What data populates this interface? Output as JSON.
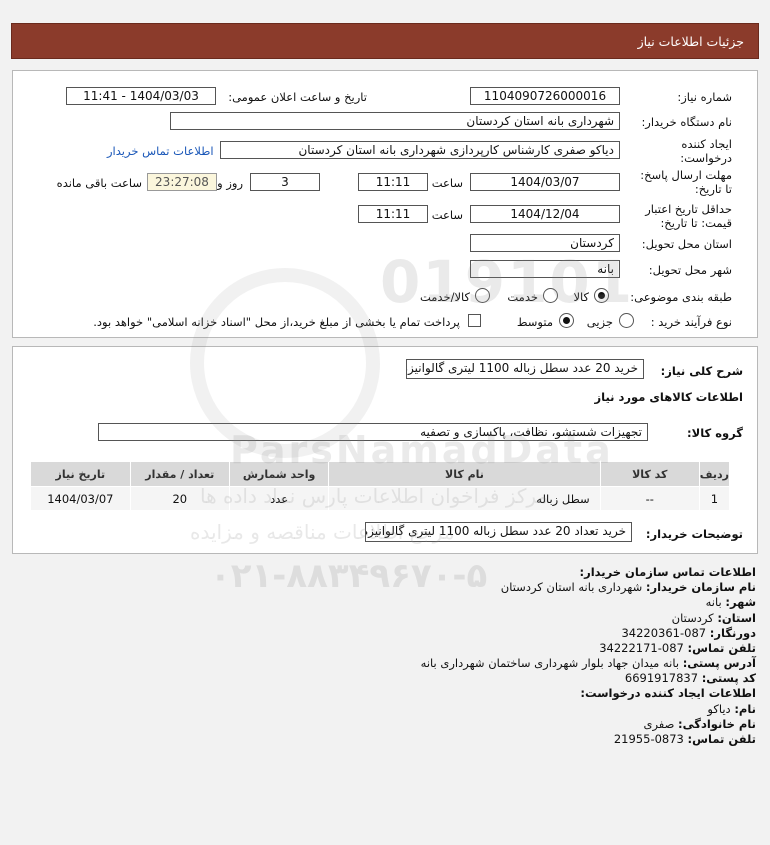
{
  "header": {
    "title": "جزئیات اطلاعات نیاز"
  },
  "form": {
    "need_number_label": "شماره نیاز:",
    "need_number": "1104090726000016",
    "announce_label": "تاریخ و ساعت اعلان عمومی:",
    "announce_value": "1404/03/03 - 11:41",
    "buyer_org_label": "نام دستگاه خریدار:",
    "buyer_org": "شهرداری بانه استان کردستان",
    "creator_label_1": "ایجاد کننده",
    "creator_label_2": "درخواست:",
    "creator": "دیاکو صفری کارشناس کارپردازی شهرداری بانه استان کردستان",
    "buyer_contact_link": "اطلاعات تماس خریدار",
    "deadline_label_1": "مهلت ارسال پاسخ:",
    "deadline_label_2": "تا تاریخ:",
    "deadline_date": "1404/03/07",
    "time_label": "ساعت",
    "deadline_time": "11:11",
    "days_value": "3",
    "days_label": "روز و",
    "remaining_time": "23:27:08",
    "remaining_label": "ساعت باقی مانده",
    "validity_label_1": "حداقل تاریخ اعتبار",
    "validity_label_2": "قیمت: تا تاریخ:",
    "validity_date": "1404/12/04",
    "validity_time": "11:11",
    "province_label": "استان محل تحویل:",
    "province": "کردستان",
    "city_label": "شهر محل تحویل:",
    "city": "بانه",
    "category_label": "طبقه بندی موضوعی:",
    "category_options": [
      "کالا",
      "خدمت",
      "کالا/خدمت"
    ],
    "process_label": "نوع فرآیند خرید :",
    "process_options": [
      "جزیی",
      "متوسط"
    ],
    "payment_note": "پرداخت تمام یا بخشی از مبلغ خرید،از محل \"اسناد خزانه اسلامی\" خواهد بود."
  },
  "details": {
    "summary_label": "شرح کلی نیاز:",
    "summary": "خرید 20 عدد سطل زباله 1100 لیتری گالوانیزه",
    "goods_info_title": "اطلاعات کالاهای مورد نیاز",
    "goods_group_label": "گروه کالا:",
    "goods_group": "تجهیزات شستشو، نظافت، پاکسازی و تصفیه",
    "table": {
      "headers": [
        "ردیف",
        "کد کالا",
        "نام کالا",
        "واحد شمارش",
        "تعداد / مقدار",
        "تاریخ نیاز"
      ],
      "rows": [
        [
          "1",
          "--",
          "سطل زباله",
          "عدد",
          "20",
          "1404/03/07"
        ]
      ]
    },
    "buyer_notes_label": "توضیحات خریدار:",
    "buyer_notes": "خرید تعداد 20 عدد سطل زباله 1100 لیتری گالوانیزه"
  },
  "contact": {
    "title": "اطلاعات تماس سازمان خریدار:",
    "org_label": "نام سازمان خریدار:",
    "org": "شهرداری بانه استان کردستان",
    "city_label": "شهر:",
    "city": "بانه",
    "province_label": "استان:",
    "province": "کردستان",
    "fax_label": "دورنگار:",
    "fax": "087-34220361",
    "phone_label": "تلفن تماس:",
    "phone": "087-34222171",
    "address_label": "آدرس پستی:",
    "address": "بانه میدان جهاد بلوار شهرداری ساختمان شهرداری بانه",
    "postal_label": "کد پستی:",
    "postal": "6691917837",
    "creator_title": "اطلاعات ایجاد کننده درخواست:",
    "name_label": "نام:",
    "name": "دیاکو",
    "family_label": "نام خانوادگی:",
    "family": "صفری",
    "creator_phone_label": "تلفن تماس:",
    "creator_phone": "0873-21955"
  },
  "watermark": {
    "number": "019101",
    "brand": "ParsNamadData",
    "line1": "مرکز فراخوان اطلاعات پارس نماد داده ها",
    "line2": "مرجع اطلاعات مناقصه و مزایده",
    "phone": "۰۲۱-۸۸۳۴۹۶۷۰-۵"
  }
}
